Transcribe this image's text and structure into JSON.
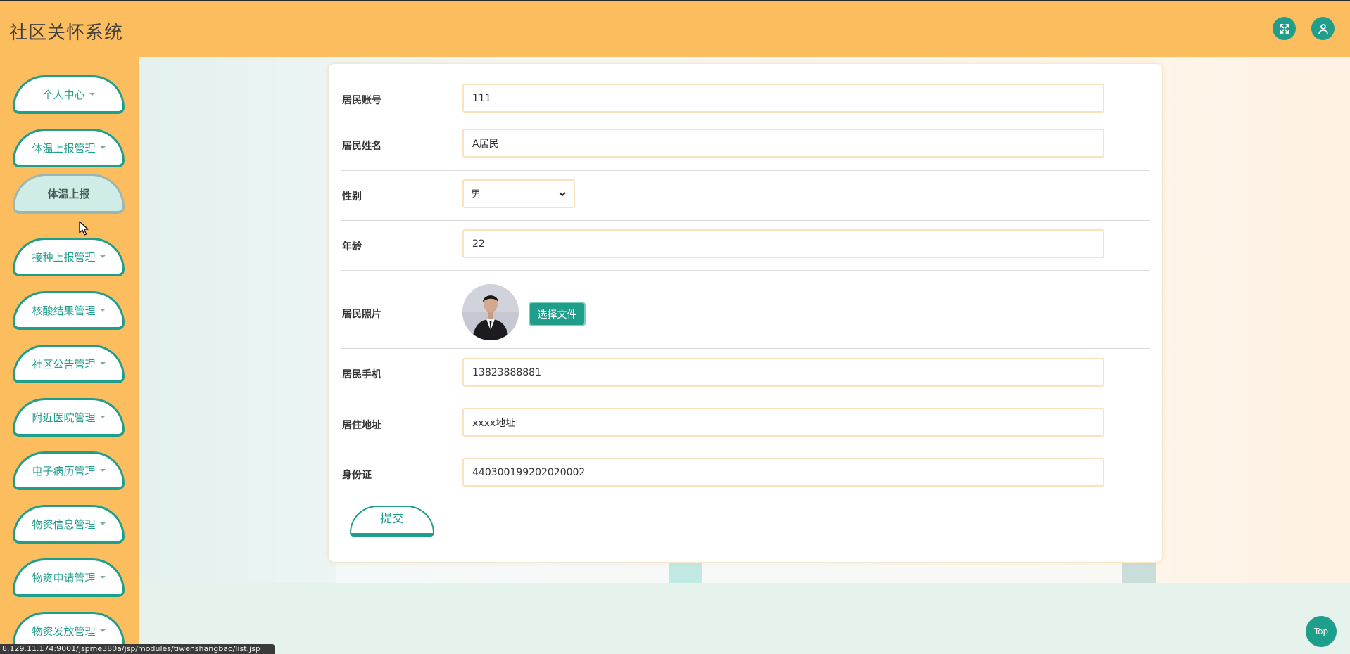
{
  "header": {
    "app_title": "社区关怀系统"
  },
  "sidebar": {
    "items": [
      {
        "label": "个人中心",
        "expanded": false
      },
      {
        "label": "体温上报管理",
        "expanded": true
      },
      {
        "label": "接种上报管理",
        "expanded": false
      },
      {
        "label": "核酸结果管理",
        "expanded": false
      },
      {
        "label": "社区公告管理",
        "expanded": false
      },
      {
        "label": "附近医院管理",
        "expanded": false
      },
      {
        "label": "电子病历管理",
        "expanded": false
      },
      {
        "label": "物资信息管理",
        "expanded": false
      },
      {
        "label": "物资申请管理",
        "expanded": false
      },
      {
        "label": "物资发放管理",
        "expanded": false
      }
    ],
    "subitem": {
      "label": "体温上报"
    }
  },
  "form": {
    "account": {
      "label": "居民账号",
      "value": "111"
    },
    "name": {
      "label": "居民姓名",
      "value": "A居民"
    },
    "gender": {
      "label": "性别",
      "value": "男"
    },
    "age": {
      "label": "年龄",
      "value": "22"
    },
    "photo": {
      "label": "居民照片",
      "button": "选择文件"
    },
    "phone": {
      "label": "居民手机",
      "value": "13823888881"
    },
    "address": {
      "label": "居住地址",
      "value": "xxxx地址"
    },
    "idcard": {
      "label": "身份证",
      "value": "440300199202020002"
    },
    "submit": "提交"
  },
  "footer": {
    "top_label": "Top",
    "status_url": "8.129.11.174:9001/jspme380a/jsp/modules/tiwenshangbao/list.jsp"
  },
  "colors": {
    "primary": "#1f9e8c",
    "header_bg": "#fcbd5f",
    "input_border": "#fbe2bf"
  }
}
